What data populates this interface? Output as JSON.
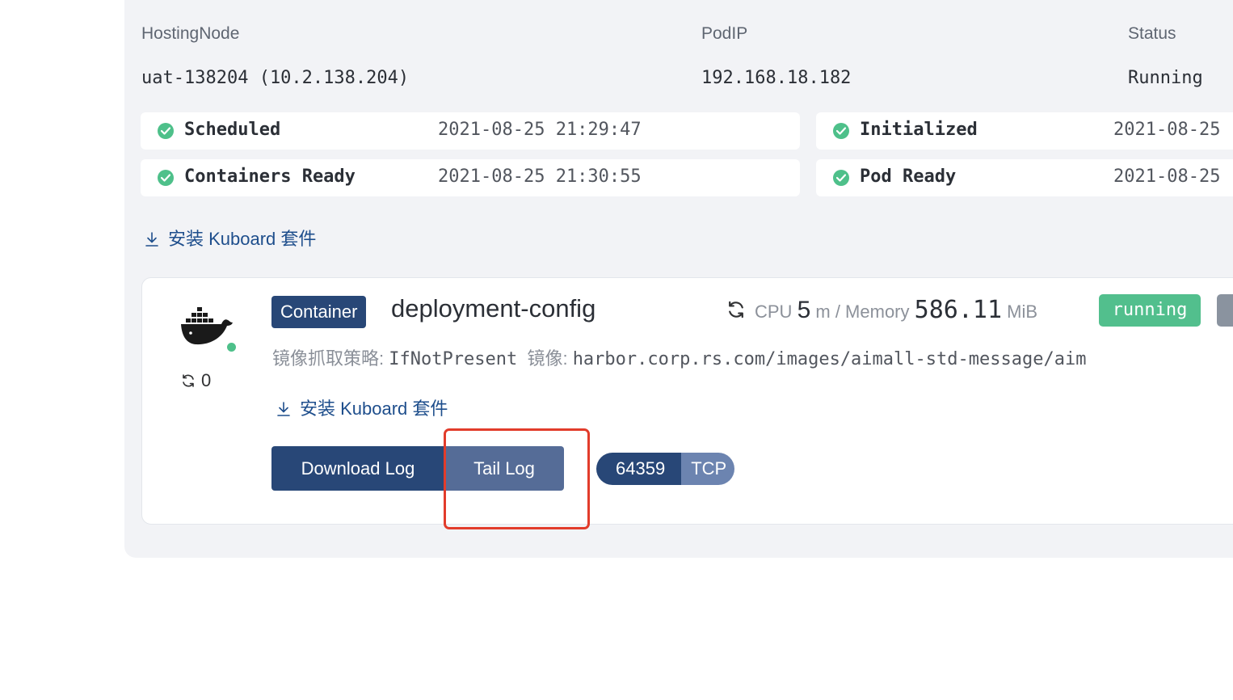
{
  "pod_info": {
    "hosting_node_label": "HostingNode",
    "hosting_node_value": "uat-138204 (10.2.138.204)",
    "pod_ip_label": "PodIP",
    "pod_ip_value": "192.168.18.182",
    "status_label": "Status",
    "status_value": "Running"
  },
  "conditions": [
    {
      "name": "Scheduled",
      "time": "2021-08-25 21:29:47"
    },
    {
      "name": "Initialized",
      "time": "2021-08-25"
    },
    {
      "name": "Containers Ready",
      "time": "2021-08-25 21:30:55"
    },
    {
      "name": "Pod Ready",
      "time": "2021-08-25"
    }
  ],
  "install_link_label": "安装 Kuboard 套件",
  "container": {
    "tag": "Container",
    "name": "deployment-config",
    "restart_count": "0",
    "cpu_label": "CPU",
    "cpu_value": "5",
    "cpu_unit": "m / Memory",
    "memory_value": "586.11",
    "memory_unit": "MiB",
    "state_badge": "running",
    "pull_policy_label": "镜像抓取策略:",
    "pull_policy_value": "IfNotPresent",
    "image_label": "镜像:",
    "image_value": "harbor.corp.rs.com/images/aimall-std-message/aim",
    "install_link_label": "安装 Kuboard 套件",
    "download_log_label": "Download Log",
    "tail_log_label": "Tail Log",
    "port_number": "64359",
    "port_protocol": "TCP"
  },
  "colors": {
    "primary": "#284777",
    "secondary": "#556c97",
    "success": "#4ec08a",
    "highlight": "#e23c2b"
  }
}
